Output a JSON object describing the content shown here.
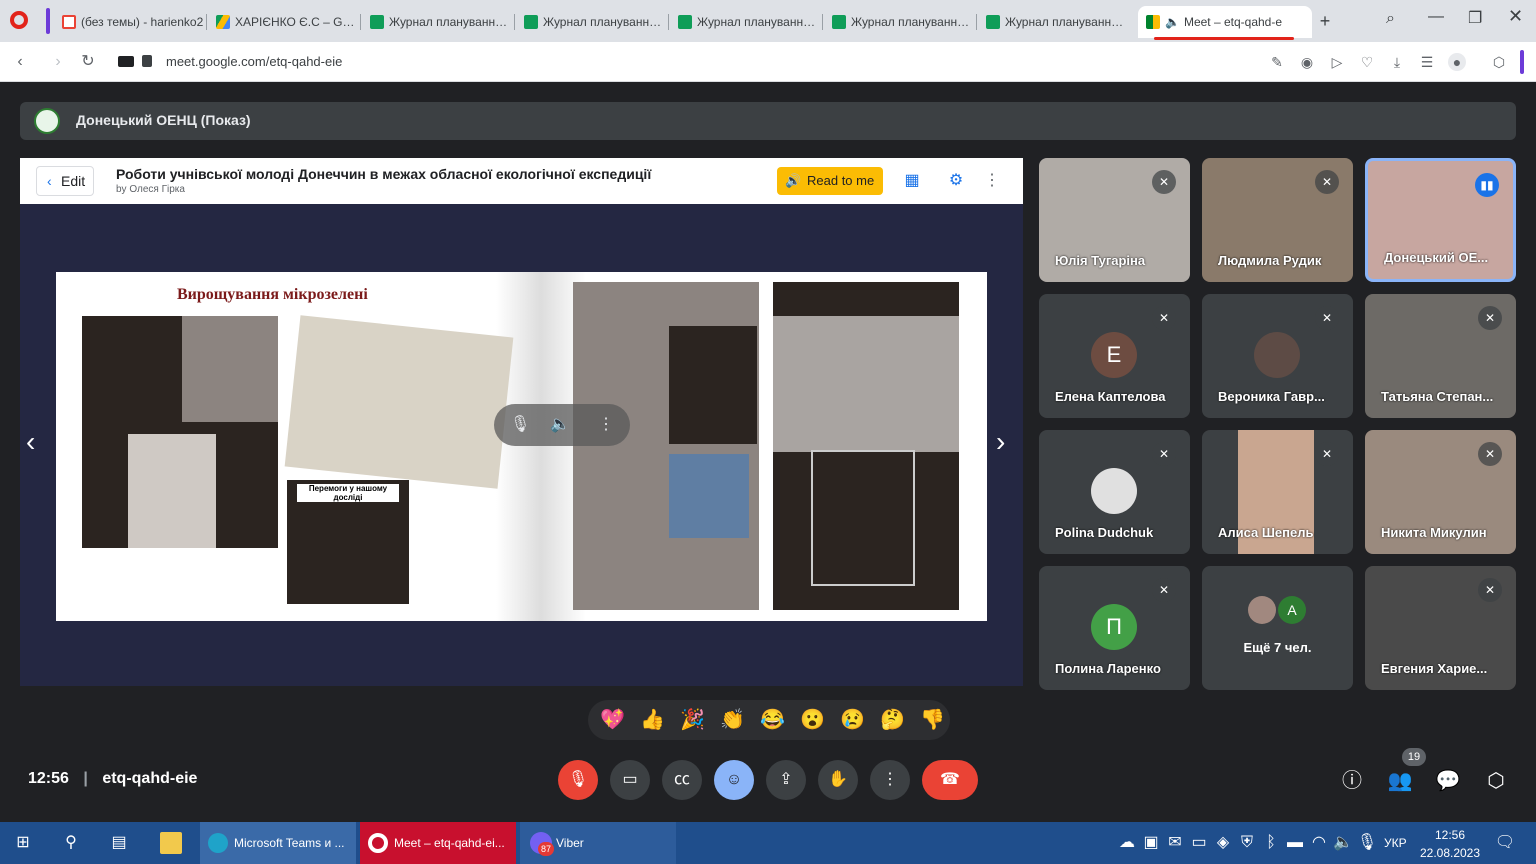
{
  "browser": {
    "tabs": [
      {
        "title": "(без темы) - harienko2",
        "icon": "gmail-icon"
      },
      {
        "title": "ХАРІЄНКО Є.С – Googl",
        "icon": "google-drive-icon"
      },
      {
        "title": "Журнал планування та",
        "icon": "google-sheets-icon"
      },
      {
        "title": "Журнал планування та",
        "icon": "google-sheets-icon"
      },
      {
        "title": "Журнал планування та",
        "icon": "google-sheets-icon"
      },
      {
        "title": "Журнал планування та",
        "icon": "google-sheets-icon"
      },
      {
        "title": "Журнал планування та",
        "icon": "google-sheets-icon"
      },
      {
        "title": "Meet – etq-qahd-e",
        "icon": "google-meet-icon",
        "active": true
      }
    ],
    "url": "meet.google.com/etq-qahd-eie"
  },
  "meet": {
    "presenter_banner": "Донецький ОЕНЦ (Показ)",
    "book": {
      "edit_label": "Edit",
      "title": "Роботи учнівської молоді Донеччин в межах обласної екологічної експедиції",
      "author": "by Олеся Гірка",
      "read_label": "Read to me",
      "slide_title": "Вирощування мікрозелені",
      "caption": "Перемоги у нашому досліді"
    },
    "participants": [
      {
        "name": "Юлія Тугаріна",
        "muted": true
      },
      {
        "name": "Людмила Рудик",
        "muted": true
      },
      {
        "name": "Донецький ОЕ...",
        "muted": false,
        "speaking": true
      },
      {
        "name": "Елена Каптелова",
        "muted": true,
        "initial": "Е",
        "color": "#6d4c41"
      },
      {
        "name": "Вероника Гавр...",
        "muted": true
      },
      {
        "name": "Татьяна Степан...",
        "muted": true
      },
      {
        "name": "Polina Dudchuk",
        "muted": true
      },
      {
        "name": "Алиса Шепель",
        "muted": true
      },
      {
        "name": "Никита Микулин",
        "muted": true
      },
      {
        "name": "Полина Ларенко",
        "muted": true,
        "initial": "П",
        "color": "#43a047"
      },
      {
        "name": "Ещё 7 чел.",
        "initial": "A",
        "color": "#2e7d32"
      },
      {
        "name": "Евгения Харие...",
        "muted": true
      }
    ],
    "emojis": [
      "💖",
      "👍",
      "🎉",
      "👏",
      "😂",
      "😮",
      "😢",
      "🤔",
      "👎"
    ],
    "time": "12:56",
    "meeting_code": "etq-qahd-eie",
    "people_count": "19"
  },
  "taskbar": {
    "apps": [
      "Microsoft Teams и ...",
      "Meet – etq-qahd-ei...",
      "Viber"
    ],
    "viber_badge": "87",
    "lang": "УКР",
    "time": "12:56",
    "date": "22.08.2023"
  }
}
